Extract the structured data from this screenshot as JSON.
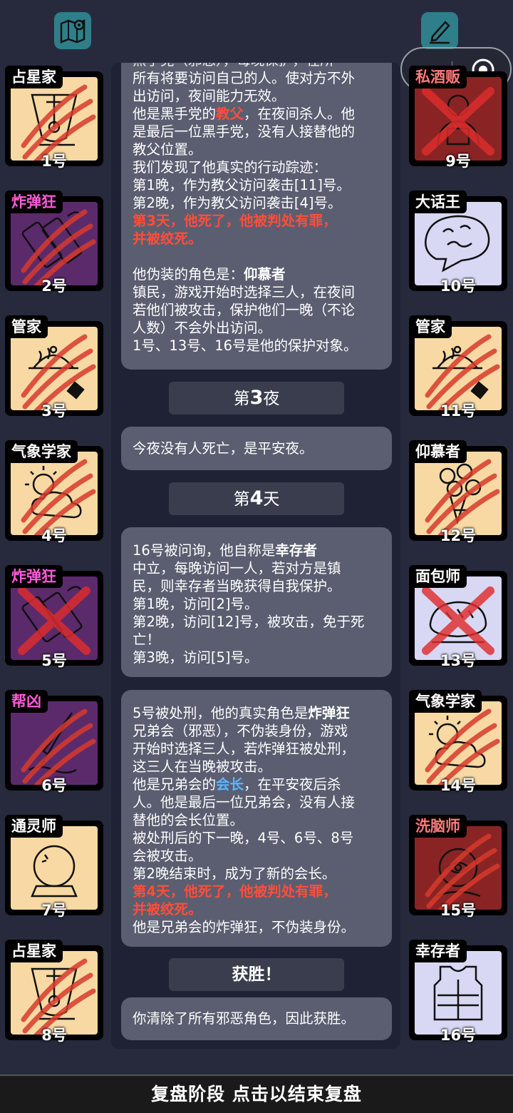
{
  "top": {
    "map_icon": "map-icon",
    "notes_icon": "pen-notes-icon"
  },
  "cards": [
    {
      "role": "占星家",
      "num": "1号",
      "bg": "#f8d9a3",
      "tag_color": "#ffffff",
      "icon": "sextant-icon",
      "dead": "scratch"
    },
    {
      "role": "炸弹狂",
      "num": "2号",
      "bg": "#5b2a6b",
      "tag_color": "#ff5ad8",
      "icon": "bomb-icon",
      "dead": "scratch"
    },
    {
      "role": "管家",
      "num": "3号",
      "bg": "#f8d9a3",
      "tag_color": "#ffffff",
      "icon": "butler-tray-icon",
      "dead": "scratch"
    },
    {
      "role": "气象学家",
      "num": "4号",
      "bg": "#f8d9a3",
      "tag_color": "#ffffff",
      "icon": "weather-icon",
      "dead": "scratch"
    },
    {
      "role": "炸弹狂",
      "num": "5号",
      "bg": "#5b2a6b",
      "tag_color": "#ff5ad8",
      "icon": "bomb-icon",
      "dead": "cross"
    },
    {
      "role": "帮凶",
      "num": "6号",
      "bg": "#5b2a6b",
      "tag_color": "#ff5ad8",
      "icon": "knife-icon",
      "dead": "scratch"
    },
    {
      "role": "通灵师",
      "num": "7号",
      "bg": "#f8d9a3",
      "tag_color": "#ffffff",
      "icon": "crystal-ball-icon",
      "dead": "none"
    },
    {
      "role": "占星家",
      "num": "8号",
      "bg": "#f8d9a3",
      "tag_color": "#ffffff",
      "icon": "sextant-icon",
      "dead": "scratch"
    },
    {
      "role": "私酒贩",
      "num": "9号",
      "bg": "#8a2424",
      "tag_color": "#ff7a7a",
      "icon": "bootlegger-icon",
      "dead": "cross"
    },
    {
      "role": "大话王",
      "num": "10号",
      "bg": "#d8d8f4",
      "tag_color": "#ffffff",
      "icon": "speech-bubble-icon",
      "dead": "none"
    },
    {
      "role": "管家",
      "num": "11号",
      "bg": "#f8d9a3",
      "tag_color": "#ffffff",
      "icon": "butler-tray-icon",
      "dead": "scratch"
    },
    {
      "role": "仰慕者",
      "num": "12号",
      "bg": "#f8d9a3",
      "tag_color": "#ffffff",
      "icon": "flower-bouquet-icon",
      "dead": "scratch"
    },
    {
      "role": "面包师",
      "num": "13号",
      "bg": "#d8d8f4",
      "tag_color": "#ffffff",
      "icon": "bread-icon",
      "dead": "cross"
    },
    {
      "role": "气象学家",
      "num": "14号",
      "bg": "#f8d9a3",
      "tag_color": "#ffffff",
      "icon": "weather-icon",
      "dead": "scratch"
    },
    {
      "role": "洗脑师",
      "num": "15号",
      "bg": "#8a2424",
      "tag_color": "#ff7a7a",
      "icon": "brainwash-icon",
      "dead": "scratch"
    },
    {
      "role": "幸存者",
      "num": "16号",
      "bg": "#d8d8f4",
      "tag_color": "#ffffff",
      "icon": "vest-icon",
      "dead": "none"
    }
  ],
  "msg1": {
    "l0": "黑手党（邪恶），每晚保护，在所",
    "l1": "所有将要访问自己的人。使对方不外",
    "l2": "出访问，夜间能力无效。",
    "l3a": "他是黑手党的",
    "l3b": "教父",
    "l3c": "，在夜间杀人。他",
    "l4": "是最后一位黑手党，没有人接替他的",
    "l5": "教父位置。",
    "l6": "我们发现了他真实的行动踪迹：",
    "l7": "第1晚，作为教父访问袭击[11]号。",
    "l8": "第2晚，作为教父访问袭击[4]号。",
    "l9": "第3天，他死了，他被判处有罪，",
    "l10": "并被绞死。",
    "l11a": "他伪装的角色是：",
    "l11b": "仰慕者",
    "l12": "镇民，游戏开始时选择三人，在夜间",
    "l13": "若他们被攻击，保护他们一晚（不论",
    "l14": "人数）不会外出访问。",
    "l15": "1号、13号、16号是他的保护对象。"
  },
  "night3": {
    "pre": "第",
    "num": "3",
    "post": "夜"
  },
  "msg2": "今夜没有人死亡，是平安夜。",
  "day4": {
    "pre": "第",
    "num": "4",
    "post": "天"
  },
  "msg3": {
    "l0a": "16号被问询，他自称是",
    "l0b": "幸存者",
    "l1": "中立，每晚访问一人，若对方是镇",
    "l2": "民，则幸存者当晚获得自我保护。",
    "l3": "第1晚，访问[2]号。",
    "l4": "第2晚，访问[12]号，被攻击，免于死",
    "l5": "亡！",
    "l6": "第3晚，访问[5]号。"
  },
  "msg4": {
    "l0a": "5号被处刑，他的真实角色是",
    "l0b": "炸弹狂",
    "l1": "兄弟会（邪恶），不伪装身份，游戏",
    "l2": "开始时选择三人，若炸弹狂被处刑，",
    "l3": "这三人在当晚被攻击。",
    "l4a": "他是兄弟会的",
    "l4b": "会长",
    "l4c": "，在平安夜后杀",
    "l5": "人。他是最后一位兄弟会，没有人接",
    "l6": "替他的会长位置。",
    "l7": "被处刑后的下一晚，4号、6号、8号",
    "l8": "会被攻击。",
    "l9": "第2晚结束时，成为了新的会长。",
    "l10": "第4天，他死了，他被判处有罪，",
    "l11": "并被绞死。",
    "l12": "他是兄弟会的炸弹狂，不伪装身份。"
  },
  "win": {
    "label": "获胜！"
  },
  "msg5": "你清除了所有邪恶角色，因此获胜。",
  "bottom": {
    "label": "复盘阶段 点击以结束复盘"
  }
}
